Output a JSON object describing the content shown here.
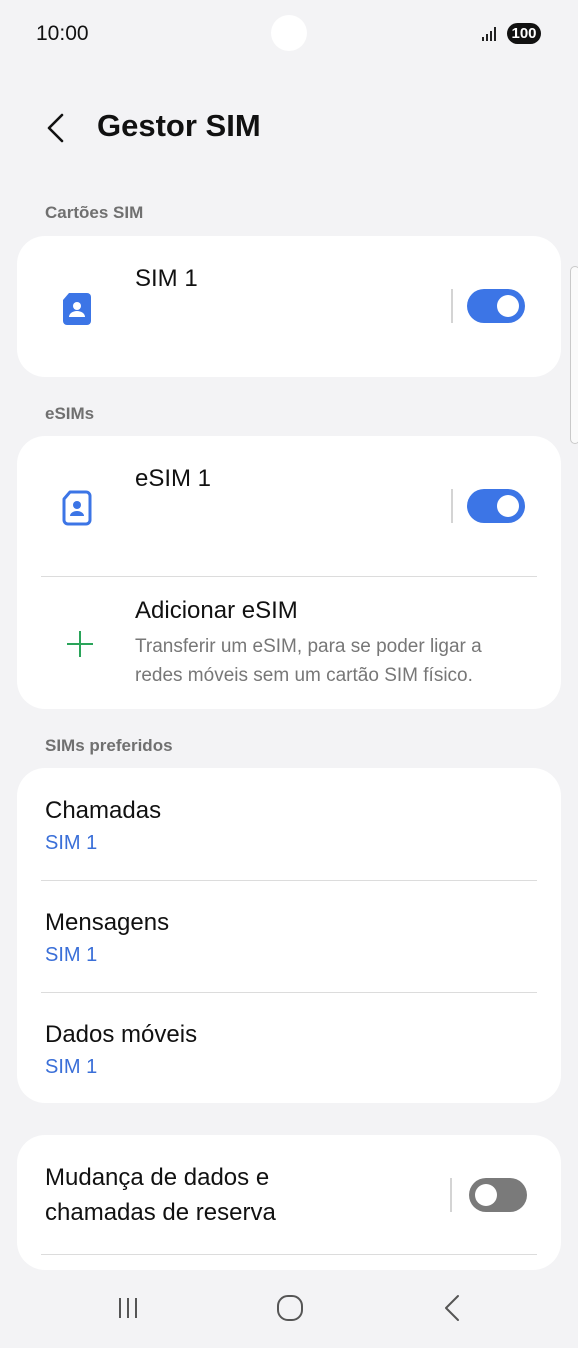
{
  "status": {
    "time": "10:00",
    "battery": "100"
  },
  "header": {
    "title": "Gestor SIM"
  },
  "sections": {
    "sim_cards": "Cartões SIM",
    "esims": "eSIMs",
    "preferred": "SIMs preferidos"
  },
  "sim_cards": [
    {
      "name": "SIM 1",
      "enabled": true
    }
  ],
  "esims": [
    {
      "name": "eSIM 1",
      "enabled": true
    }
  ],
  "add_esim": {
    "title": "Adicionar eSIM",
    "description_line1": "Transferir um eSIM, para se poder ligar a",
    "description_line2": "redes móveis sem um cartão SIM físico."
  },
  "preferred": [
    {
      "label": "Chamadas",
      "value": "SIM 1"
    },
    {
      "label": "Mensagens",
      "value": "SIM 1"
    },
    {
      "label": "Dados móveis",
      "value": "SIM 1"
    }
  ],
  "backup": {
    "line1": "Mudança de dados e",
    "line2": "chamadas de reserva",
    "enabled": false
  },
  "colors": {
    "accent": "#3c75e6",
    "background": "#f3f3f5",
    "plus": "#2aa45a"
  },
  "icons": [
    "signal-icon",
    "back-arrow-icon",
    "sim-card-icon",
    "esim-icon",
    "plus-icon",
    "recents-icon",
    "home-icon",
    "nav-back-icon"
  ]
}
